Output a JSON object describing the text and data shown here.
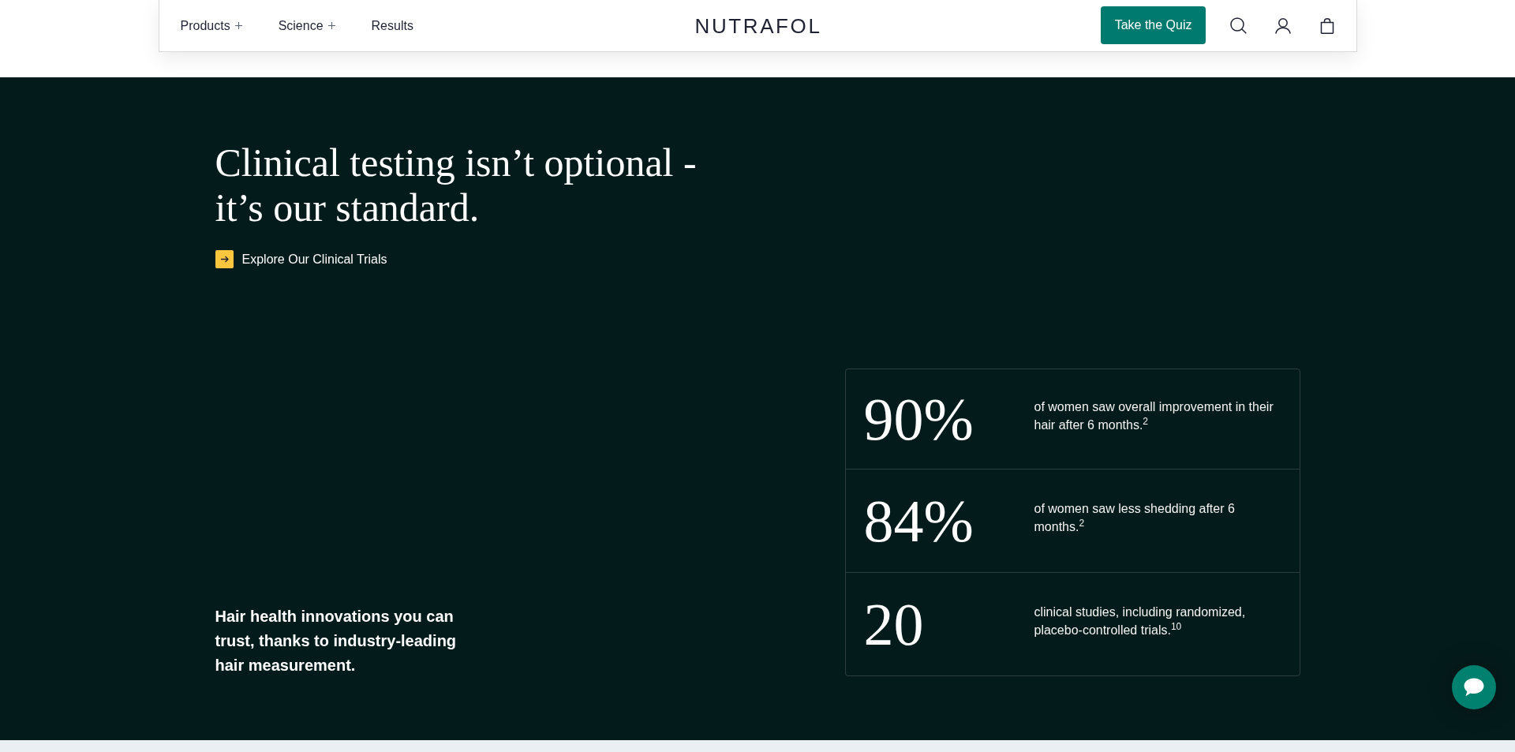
{
  "nav": {
    "links": [
      {
        "label": "Products",
        "expandable": true
      },
      {
        "label": "Science",
        "expandable": true
      },
      {
        "label": "Results",
        "expandable": false
      }
    ],
    "logo": "NUTRAFOL",
    "cta": "Take the Quiz"
  },
  "hero": {
    "heading": "Clinical testing isn’t optional - it’s our standard.",
    "link": "Explore Our Clinical Trials",
    "tagline": "Hair health innovations you can trust, thanks to industry-leading hair measurement."
  },
  "stats": [
    {
      "value": "90%",
      "description": "of women saw overall improvement in their hair after 6 months.$^{2}$"
    },
    {
      "value": "84%",
      "description": "of women saw less shedding after 6 months.$^{2}$"
    },
    {
      "value": "20",
      "description": "clinical studies, including randomized, placebo-controlled trials.$^{10}$"
    }
  ]
}
